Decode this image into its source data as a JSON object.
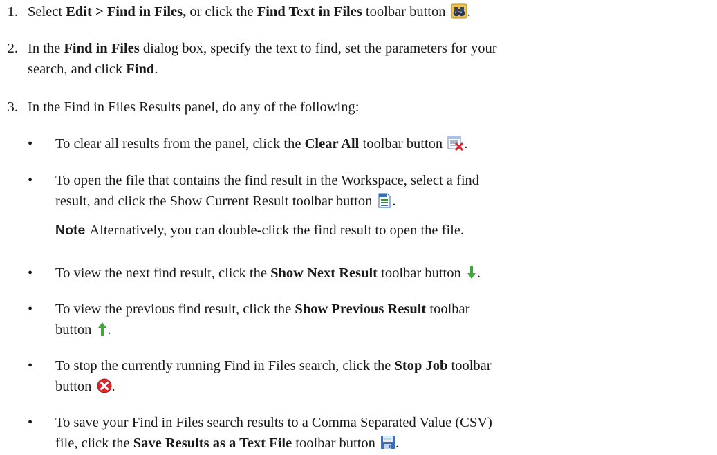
{
  "steps": [
    {
      "number": "1.",
      "p1": "Select ",
      "b1": "Edit > Find in Files,",
      "p2": " or click the ",
      "b2": "Find Text in Files",
      "p3": " toolbar button",
      "p4": ".",
      "icon": "binoculars-icon"
    },
    {
      "number": "2.",
      "line1_p1": "In the ",
      "line1_b1": "Find in Files",
      "line1_p2": " dialog box, specify the text to find, set the parameters for your",
      "line2_p1": "search, and click ",
      "line2_b1": "Find",
      "line2_p2": "."
    },
    {
      "number": "3.",
      "text": "In the Find in Files Results panel, do any of the following:"
    }
  ],
  "bullets": {
    "symbol": "•",
    "clear_all": {
      "p1": "To clear all results from the panel, click the ",
      "b1": "Clear All",
      "p2": " toolbar button",
      "p3": ".",
      "icon": "clear-all-icon"
    },
    "show_current": {
      "line1": "To open the file that contains the find result in the Workspace, select a find",
      "line2_p1": "result, and click the Show Current Result toolbar button",
      "line2_p2": ".",
      "icon": "document-icon"
    },
    "note": {
      "label": "Note",
      "text": "Alternatively, you can double-click the find result to open the file."
    },
    "show_next": {
      "p1": "To view the next find result, click the ",
      "b1": "Show Next Result",
      "p2": " toolbar button",
      "p3": ".",
      "icon": "arrow-down-icon"
    },
    "show_previous": {
      "p1": "To view the previous find result, click the ",
      "b1": "Show Previous Result",
      "p2": " toolbar",
      "line2": "button",
      "p3": ".",
      "icon": "arrow-up-icon"
    },
    "stop_job": {
      "p1": "To stop the currently running Find in Files search, click the ",
      "b1": "Stop Job",
      "p2": " toolbar",
      "line2": "button",
      "p3": ".",
      "icon": "stop-icon"
    },
    "save_results": {
      "line1": "To save your Find in Files search results to a Comma Separated Value (CSV)",
      "line2_p1": "file, click the ",
      "line2_b1": "Save Results as a Text File",
      "line2_p2": " toolbar button",
      "line2_p3": ".",
      "icon": "save-icon"
    }
  },
  "colors": {
    "text": "#1a1a1a",
    "arrow_green": "#3fa83a",
    "stop_red": "#d8262b",
    "save_blue": "#3a6fb8",
    "binocular_gold": "#d9a420"
  }
}
